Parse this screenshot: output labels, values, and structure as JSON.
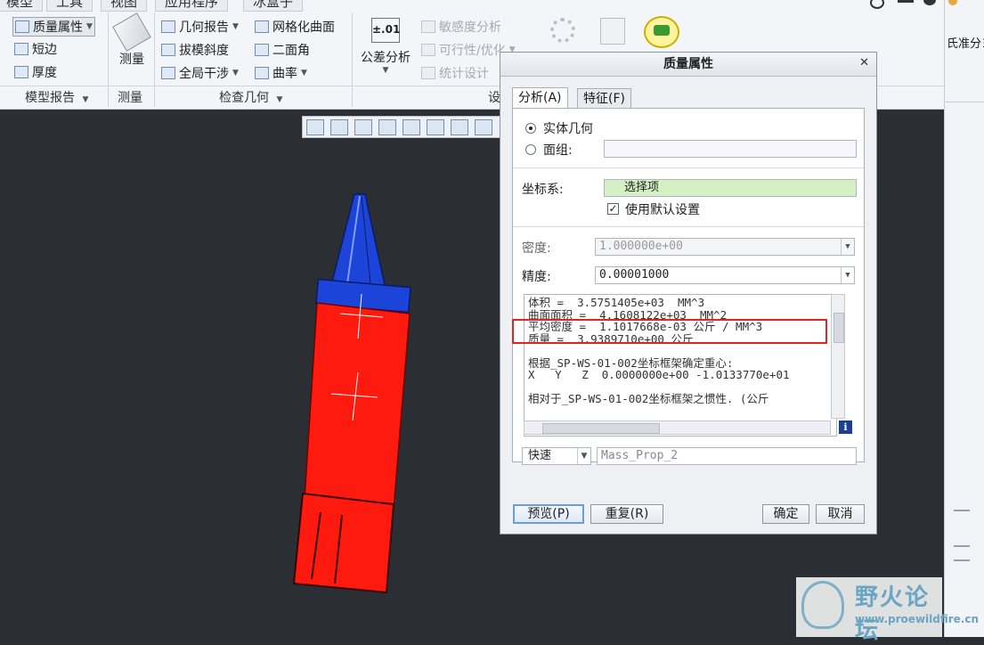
{
  "ribbon": {
    "tabs": [
      "模型",
      "工具",
      "视图",
      "应用程序",
      "冰盒子"
    ],
    "model_report": {
      "mass_props": "质量属性",
      "short_edge": "短边",
      "thickness": "厚度",
      "group_label": "模型报告"
    },
    "measure": {
      "label": "测量",
      "group_label": "测量"
    },
    "inspect": {
      "geometry_report": "几何报告",
      "draft": "拔模斜度",
      "global_interference": "全局干涉",
      "mesh_surface": "网格化曲面",
      "dihedral": "二面角",
      "curvature": "曲率",
      "group_label": "检查几何"
    },
    "tolerance": {
      "icon_text": "±.01",
      "label": "公差分析"
    },
    "design": {
      "sensitivity": "敏感度分析",
      "feasibility": "可行性/优化",
      "statistical": "统计设计",
      "group_label": "设"
    }
  },
  "right_panel": {
    "fragment": "氏准分ヨ"
  },
  "dialog": {
    "title": "质量属性",
    "tabs": [
      "分析(A)",
      "特征(F)"
    ],
    "solid_geometry": "实体几何",
    "quilt": "面组:",
    "coord_sys_label": "坐标系:",
    "coord_sys_value": "选择项",
    "use_default": "使用默认设置",
    "density_label": "密度:",
    "density_value": "1.000000e+00",
    "precision_label": "精度:",
    "precision_value": "0.00001000",
    "results": "体积 =  3.5751405e+03  MM^3\n曲面面积 =  4.1608122e+03  MM^2\n平均密度 =  1.1017668e-03 公斤 / MM^3\n质量 =  3.9389710e+00 公斤\n\n根据_SP-WS-01-002坐标框架确定重心:\nX   Y   Z  0.0000000e+00 -1.0133770e+01\n\n相对于_SP-WS-01-002坐标框架之惯性. (公斤",
    "mode": "快速",
    "feature_name": "Mass_Prop_2",
    "info_icon": "i",
    "buttons": {
      "preview": "预览(P)",
      "repeat": "重复(R)",
      "ok": "确定",
      "cancel": "取消"
    }
  },
  "watermark": {
    "title": "野火论坛",
    "url": "www.proewildfire.cn"
  },
  "colors": {
    "accent_red": "#e2261f",
    "part_red": "#ff1a0f",
    "part_blue": "#1c44d8"
  }
}
